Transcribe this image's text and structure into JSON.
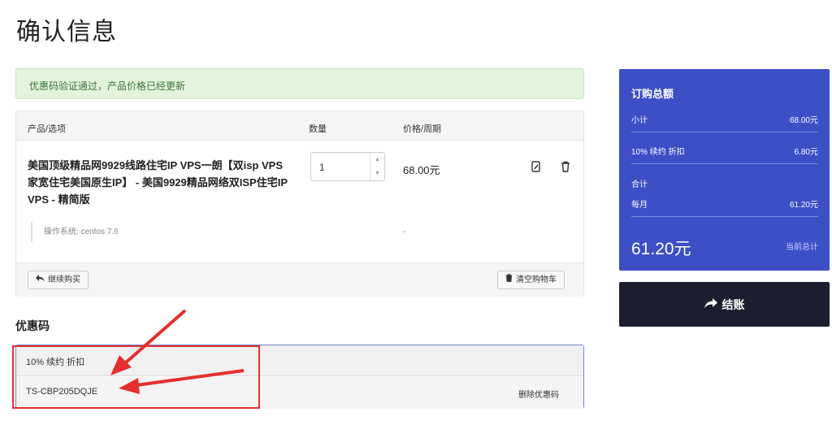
{
  "page": {
    "title": "确认信息"
  },
  "alert": {
    "message": "优惠码验证通过，产品价格已经更新"
  },
  "cart": {
    "headers": {
      "product": "产品/选项",
      "qty": "数量",
      "price": "价格/周期"
    },
    "item": {
      "name": "美国顶级精品网9929线路住宅IP VPS一朗【双isp VPS 家宽住宅美国原生IP】 - 美国9929精品网络双ISP住宅IP VPS - 精简版",
      "qty": "1",
      "price": "68.00元",
      "option_label": "操作系统: centos 7.6",
      "option_price": "-"
    },
    "continue_label": "继续购买",
    "empty_label": "清空购物车"
  },
  "promo": {
    "title": "优惠码",
    "description": "10% 续约 折扣",
    "code": "TS-CBP205DQJE",
    "remove_label": "删除优惠码"
  },
  "summary": {
    "title": "订购总额",
    "subtotal_label": "小计",
    "subtotal_value": "68.00元",
    "discount_label": "10% 续约 折扣",
    "discount_value": "6.80元",
    "total_section_label": "合计",
    "monthly_label": "每月",
    "monthly_value": "61.20元",
    "total_value": "61.20元",
    "total_note": "当前总计"
  },
  "checkout": {
    "label": "结账"
  },
  "colors": {
    "summary_bg": "#3c4fc7",
    "checkout_bg": "#1b1e2f",
    "alert_bg": "#e3f3dc",
    "annotation": "#e5302f"
  }
}
